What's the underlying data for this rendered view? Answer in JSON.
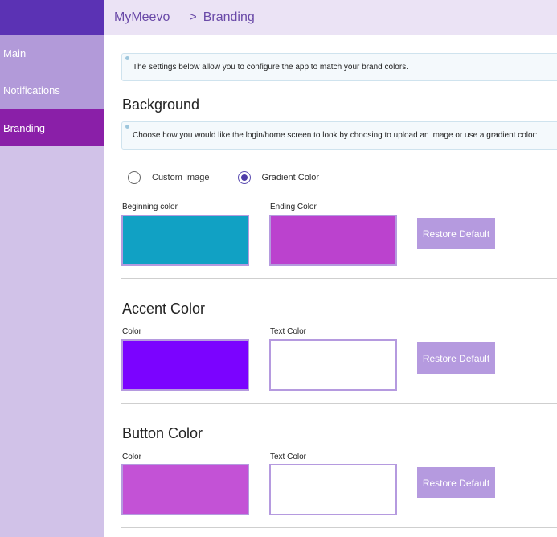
{
  "header": {
    "app_name": "MyMeevo",
    "separator": ">",
    "current_page": "Branding"
  },
  "sidebar": {
    "items": [
      {
        "label": "Main",
        "active": false
      },
      {
        "label": "Notifications",
        "active": false
      },
      {
        "label": "Branding",
        "active": true
      }
    ]
  },
  "main": {
    "intro_text": "The settings below allow you to configure the app to match your brand colors.",
    "background": {
      "title": "Background",
      "info_text": "Choose how you would like the login/home screen to look by choosing to upload an image or use a gradient color:",
      "options": [
        {
          "label": "Custom Image",
          "selected": false
        },
        {
          "label": "Gradient Color",
          "selected": true
        }
      ],
      "beginning_color_label": "Beginning color",
      "beginning_color": "#11a1c4",
      "ending_color_label": "Ending Color",
      "ending_color": "#bb42ce",
      "restore_label": "Restore Default"
    },
    "accent": {
      "title": "Accent Color",
      "color_label": "Color",
      "color": "#7b03ff",
      "text_color_label": "Text Color",
      "text_color": "#ffffff",
      "restore_label": "Restore Default"
    },
    "button": {
      "title": "Button Color",
      "color_label": "Color",
      "color": "#c352d6",
      "text_color_label": "Text Color",
      "text_color": "#ffffff",
      "restore_label": "Restore Default"
    }
  }
}
